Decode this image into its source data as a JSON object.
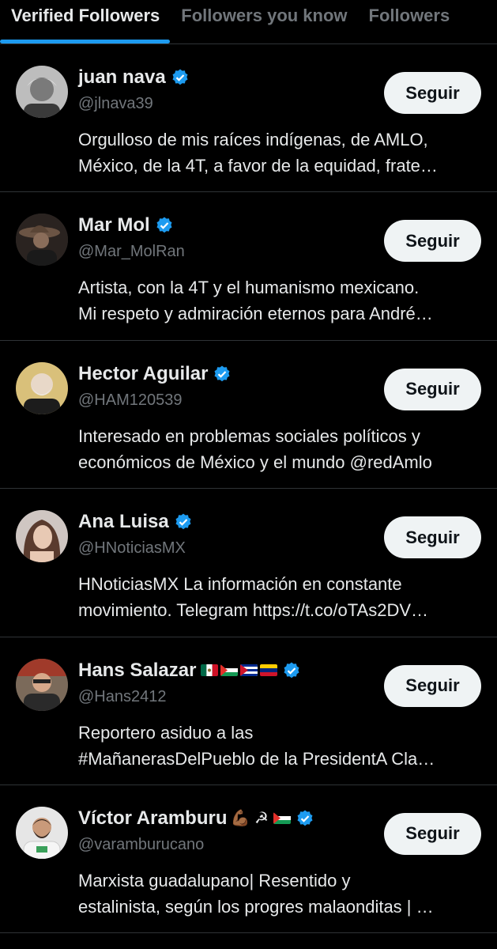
{
  "tabs": [
    {
      "label": "Verified Followers",
      "active": true
    },
    {
      "label": "Followers you know",
      "active": false
    },
    {
      "label": "Followers",
      "active": false
    }
  ],
  "colors": {
    "accent": "#1d9bf0",
    "background": "#000000",
    "muted": "#71767b",
    "button_bg": "#eff3f4"
  },
  "follow_label": "Seguir",
  "users": [
    {
      "name": "juan nava",
      "handle": "@jlnava39",
      "verified_icon": "verified-badge-icon",
      "bio": [
        "Orgulloso de mis raíces indígenas, de AMLO,",
        "México, de la 4T, a favor de la equidad, frate…"
      ]
    },
    {
      "name": "Mar Mol",
      "handle": "@Mar_MolRan",
      "verified_icon": "verified-badge-icon",
      "bio": [
        "Artista, con la 4T y el humanismo mexicano.",
        "Mi respeto y admiración eternos para André…"
      ]
    },
    {
      "name": "Hector Aguilar",
      "handle": "@HAM120539",
      "verified_icon": "verified-badge-icon",
      "bio": [
        "Interesado en problemas sociales políticos y",
        "económicos de México y el mundo @redAmlo"
      ]
    },
    {
      "name": "Ana Luisa",
      "handle": "@HNoticiasMX",
      "verified_icon": "verified-badge-icon",
      "bio": [
        "HNoticiasMX La información en constante",
        "movimiento. Telegram https://t.co/oTAs2DV…"
      ]
    },
    {
      "name": "Hans Salazar",
      "handle": "@Hans2412",
      "verified_icon": "verified-badge-icon",
      "flags": [
        "mexico-flag-icon",
        "palestine-flag-icon",
        "cuba-flag-icon",
        "venezuela-flag-icon"
      ],
      "bio": [
        "Reportero asiduo a las",
        "#MañanerasDelPueblo de la PresidentA Cla…"
      ]
    },
    {
      "name": "Víctor Aramburu",
      "handle": "@varamburucano",
      "verified_icon": "verified-badge-icon",
      "emoji": "💪🏾 ☭",
      "flags": [
        "palestine-flag-icon"
      ],
      "bio": [
        "Marxista guadalupano| Resentido y",
        "estalinista, según los progres malaonditas | …"
      ]
    }
  ]
}
